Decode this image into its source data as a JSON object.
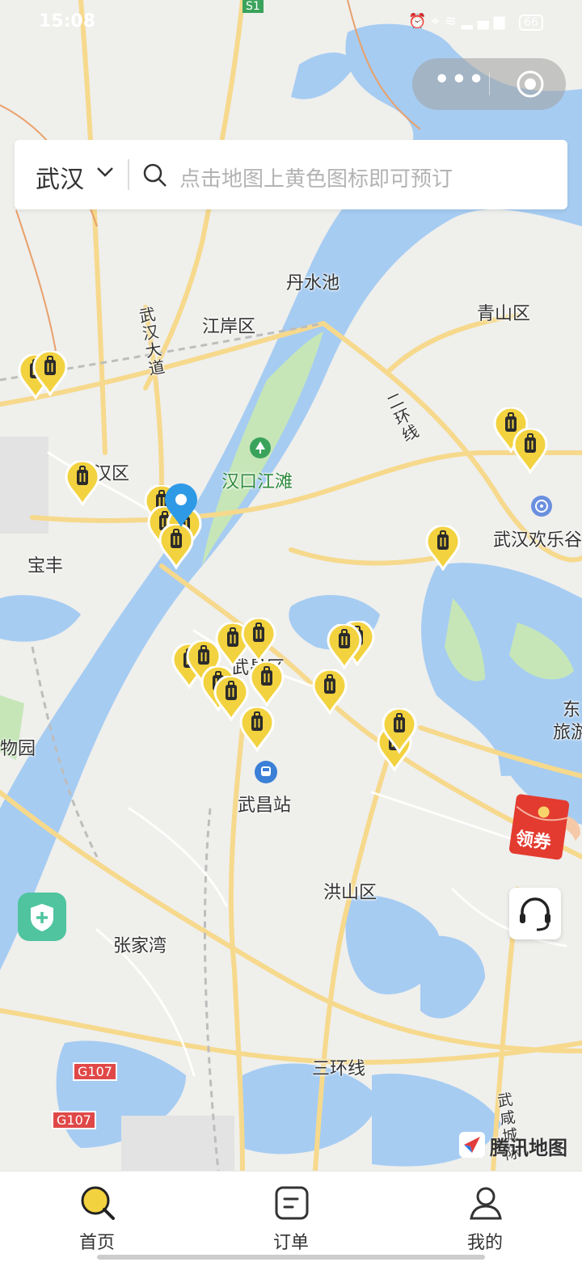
{
  "status_bar": {
    "time": "15:08",
    "battery": "66"
  },
  "search": {
    "city": "武汉",
    "placeholder": "点击地图上黄色图标即可预订"
  },
  "map": {
    "labels": {
      "danshuichi": "丹水池",
      "jiangan": "江岸区",
      "qingshan": "青山区",
      "wuhan_avenue": "武汉大道",
      "second_ring": "二环线",
      "hankou_jiangtan": "汉口江滩",
      "jianghan": "汉区",
      "baofeng": "宝丰",
      "happy_valley": "武汉欢乐谷",
      "wuchang": "武昌区",
      "dong": "东",
      "lv": "旅游",
      "zoo": "物园",
      "wuchang_station": "武昌站",
      "hongshan": "洪山区",
      "zhangjiawan": "张家湾",
      "third_ring": "三环线",
      "g107a": "G107",
      "g107b": "G107",
      "s1": "S1",
      "wuxian": "武咸城际"
    },
    "brand": "腾讯地图"
  },
  "coupon": {
    "label": "领券"
  },
  "tabs": [
    {
      "label": "首页"
    },
    {
      "label": "订单"
    },
    {
      "label": "我的"
    }
  ],
  "colors": {
    "accent": "#f2d23f",
    "water": "#a6ccf2",
    "green": "#c6e6b8",
    "pin_active": "#2e9ae6"
  }
}
